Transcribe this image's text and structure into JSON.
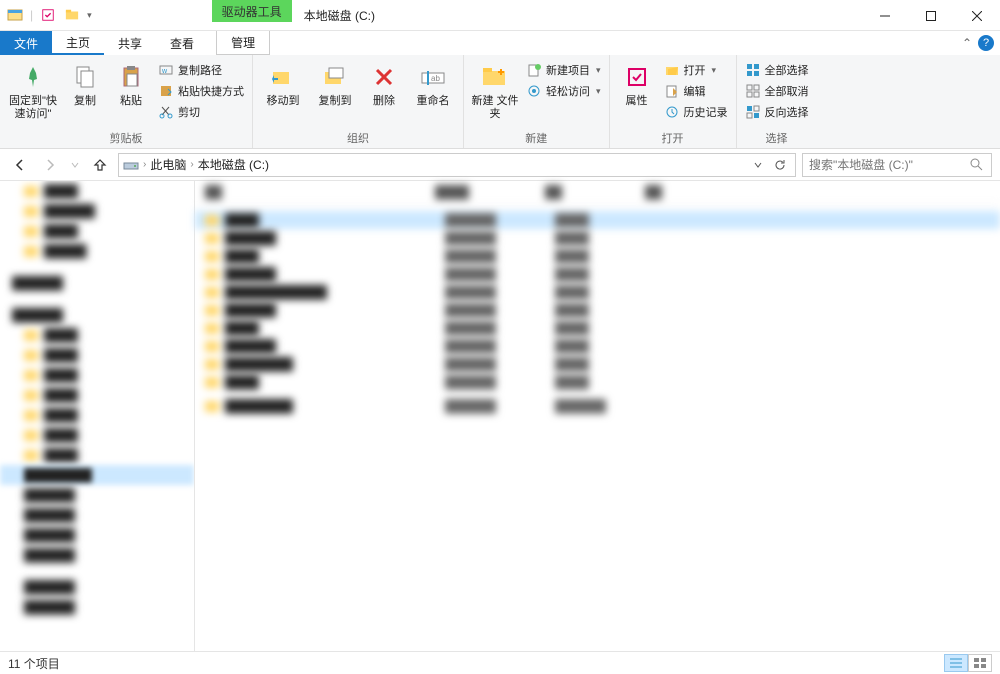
{
  "titlebar": {
    "context_tab": "驱动器工具",
    "title": "本地磁盘 (C:)"
  },
  "tabs": {
    "file": "文件",
    "home": "主页",
    "share": "共享",
    "view": "查看",
    "manage": "管理"
  },
  "ribbon": {
    "clipboard": {
      "pin": "固定到\"快\n速访问\"",
      "copy": "复制",
      "paste": "粘贴",
      "copy_path": "复制路径",
      "paste_shortcut": "粘贴快捷方式",
      "cut": "剪切",
      "label": "剪贴板"
    },
    "organize": {
      "move_to": "移动到",
      "copy_to": "复制到",
      "delete": "删除",
      "rename": "重命名",
      "label": "组织"
    },
    "new": {
      "new_folder": "新建\n文件夹",
      "new_item": "新建项目",
      "easy_access": "轻松访问",
      "label": "新建"
    },
    "open": {
      "properties": "属性",
      "open": "打开",
      "edit": "编辑",
      "history": "历史记录",
      "label": "打开"
    },
    "select": {
      "select_all": "全部选择",
      "select_none": "全部取消",
      "invert": "反向选择",
      "label": "选择"
    }
  },
  "address": {
    "crumb1": "此电脑",
    "crumb2": "本地磁盘 (C:)"
  },
  "search": {
    "placeholder": "搜索\"本地磁盘 (C:)\""
  },
  "status": {
    "count": "11 个项目"
  }
}
